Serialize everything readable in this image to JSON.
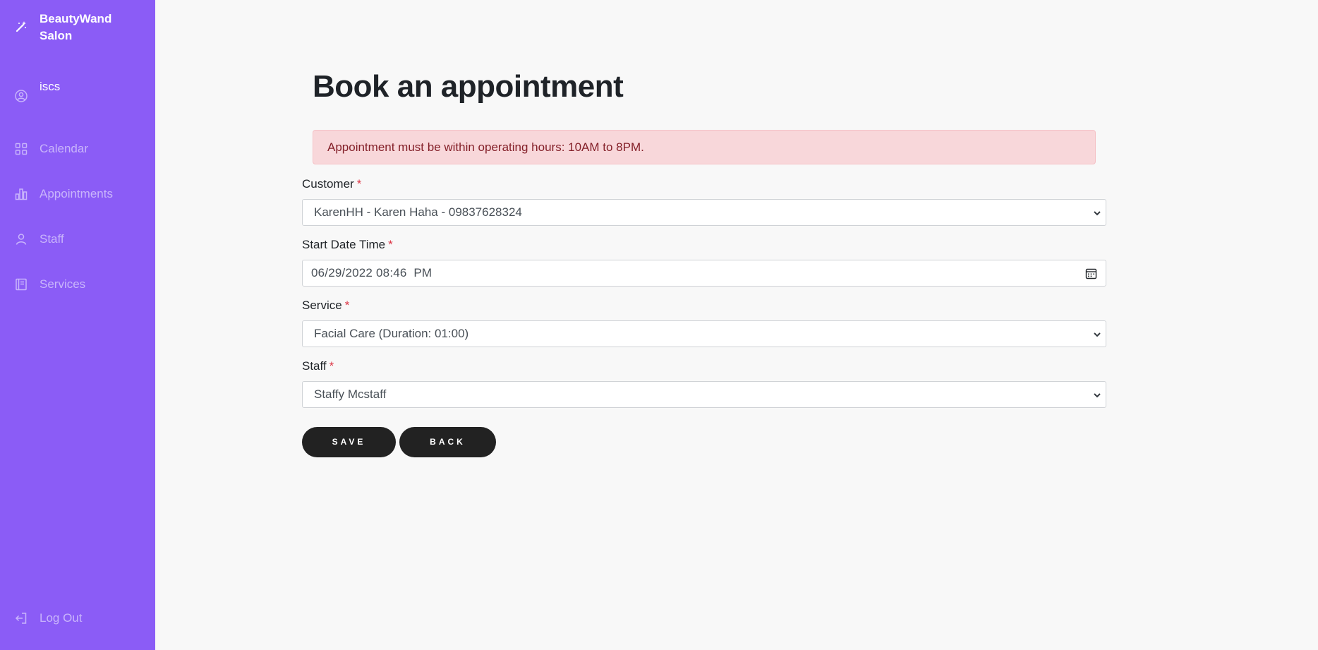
{
  "sidebar": {
    "brand": "BeautyWand Salon",
    "user": "iscs",
    "items": [
      {
        "label": "Calendar",
        "icon": "grid-icon"
      },
      {
        "label": "Appointments",
        "icon": "bar-chart-icon"
      },
      {
        "label": "Staff",
        "icon": "person-icon"
      },
      {
        "label": "Services",
        "icon": "book-icon"
      }
    ],
    "logout": "Log Out",
    "colors": {
      "background": "#8b5cf6",
      "muted_text": "#c9b5fb"
    }
  },
  "main": {
    "title": "Book an appointment",
    "alert": "Appointment must be within operating hours: 10AM to 8PM.",
    "form": {
      "customer": {
        "label": "Customer",
        "required": "*",
        "value": "KarenHH - Karen Haha - 09837628324"
      },
      "start": {
        "label": "Start Date Time",
        "required": "*",
        "value": "06/29/2022 08:46  PM"
      },
      "service": {
        "label": "Service",
        "required": "*",
        "value": "Facial Care (Duration: 01:00)"
      },
      "staff": {
        "label": "Staff",
        "required": "*",
        "value": "Staffy Mcstaff"
      }
    },
    "buttons": {
      "save": "SAVE",
      "back": "BACK"
    }
  }
}
